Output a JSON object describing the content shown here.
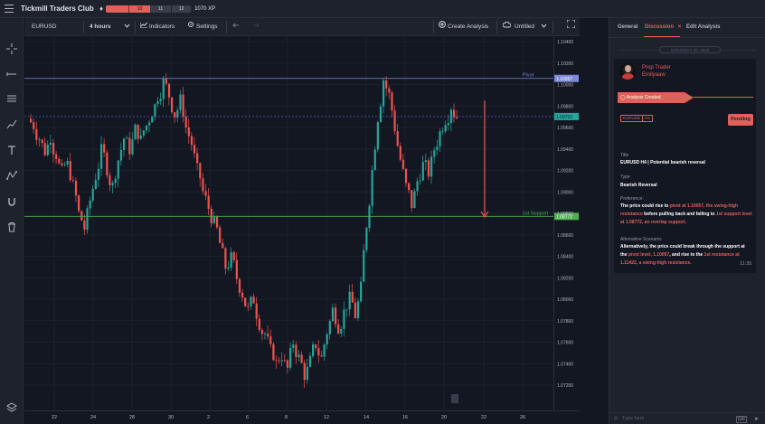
{
  "app": {
    "title": "Tickmill Traders Club",
    "xp_segments": [
      "10",
      "11",
      "12"
    ],
    "xp_total": "1070 XP",
    "accent": "#e0605a"
  },
  "toolbar": {
    "symbol": "EURUSD",
    "interval": "4 hours",
    "indicators_label": "Indicators",
    "settings_label": "Settings",
    "create_label": "Create Analysis",
    "save_label": "Untitled"
  },
  "left_tools": [
    "crosshair-icon",
    "trendline-icon",
    "horizontal-lines-icon",
    "brush-icon",
    "text-icon",
    "pattern-icon",
    "magnet-icon",
    "trash-icon",
    "layers-icon"
  ],
  "chart_data": {
    "type": "candlestick",
    "symbol": "EURUSD",
    "price_axis": [
      "1.10400",
      "1.10200",
      "1.10000",
      "1.09800",
      "1.09600",
      "1.09400",
      "1.09200",
      "1.09000",
      "1.08800",
      "1.08600",
      "1.08400",
      "1.08200",
      "1.08000",
      "1.07800",
      "1.07600",
      "1.07400",
      "1.07200"
    ],
    "time_axis": [
      "22",
      "24",
      "28",
      "30",
      "2",
      "6",
      "8",
      "12",
      "14",
      "16",
      "20",
      "22",
      "26"
    ],
    "ylim": [
      1.0712,
      1.1043
    ],
    "levels": [
      {
        "label": "Pivot",
        "price": 1.10057,
        "price_label": "1.10057",
        "color": "#7e88d8"
      },
      {
        "label": "1st Support",
        "price": 1.08772,
        "price_label": "1.08772",
        "color": "#4caf50"
      }
    ],
    "last_price": {
      "price": 1.09702,
      "price_label": "1.09702",
      "color": "#26a69a"
    },
    "candle_colors": {
      "up": "#26a69a",
      "down": "#ef5350"
    },
    "grid": true,
    "closes_path": [
      1.0962,
      1.095,
      1.0938,
      1.0952,
      1.0935,
      1.0918,
      1.0925,
      1.0905,
      1.088,
      1.0866,
      1.0892,
      1.0915,
      1.0938,
      1.0922,
      1.0905,
      1.093,
      1.095,
      1.094,
      1.0958,
      1.0948,
      1.0962,
      1.0975,
      1.099,
      1.1002,
      1.099,
      1.0972,
      1.0985,
      1.096,
      1.0945,
      1.092,
      1.09,
      1.0885,
      1.087,
      1.0852,
      1.083,
      1.0838,
      1.082,
      1.0805,
      1.079,
      1.08,
      1.0778,
      1.0768,
      1.0752,
      1.074,
      1.0748,
      1.0735,
      1.076,
      1.0745,
      1.073,
      1.0742,
      1.0758,
      1.0745,
      1.077,
      1.079,
      1.0775,
      1.0788,
      1.08,
      1.0785,
      1.081,
      1.087,
      1.092,
      1.097,
      1.1005,
      1.099,
      1.096,
      1.093,
      1.0905,
      1.0888,
      1.091,
      1.0925,
      1.0918,
      1.094,
      1.0955,
      1.0968,
      1.098,
      1.097
    ]
  },
  "panel": {
    "tabs": [
      "General",
      "Discussion",
      "Edit Analysis"
    ],
    "active_tab_close": "×",
    "date": "SATURDAY 20, 2023",
    "author_role": "Prop Trader",
    "author_name": "Emilyaaw",
    "created_label": "Analysis Created",
    "tags": [
      "EURUSD",
      "H4"
    ],
    "status": "Pending",
    "title_label": "Title",
    "title_value": "EURUSD H4 | Potential bearish reversal",
    "type_label": "Type",
    "type_value": "Bearish Reversal",
    "preference_label": "Preference:",
    "preference_parts": [
      {
        "t": "The price could rise to ",
        "hl": false
      },
      {
        "t": "pivot at 1.10057, the swing-high resistance",
        "hl": true
      },
      {
        "t": " before pulling back and falling to ",
        "hl": false
      },
      {
        "t": "1st support level at 1.08772, an overlap support.",
        "hl": true
      }
    ],
    "alt_label": "Alternative Scenario:",
    "alt_parts": [
      {
        "t": "Alternatively, the price could break through the support at the ",
        "hl": false
      },
      {
        "t": "pivot level, 1.10057",
        "hl": true
      },
      {
        "t": ", and rise to the ",
        "hl": false
      },
      {
        "t": "1st resistance at 1.11422, a swing-high resistance.",
        "hl": true
      }
    ],
    "time": "11:35",
    "input_placeholder": "Type here",
    "send_label": "GIF"
  }
}
